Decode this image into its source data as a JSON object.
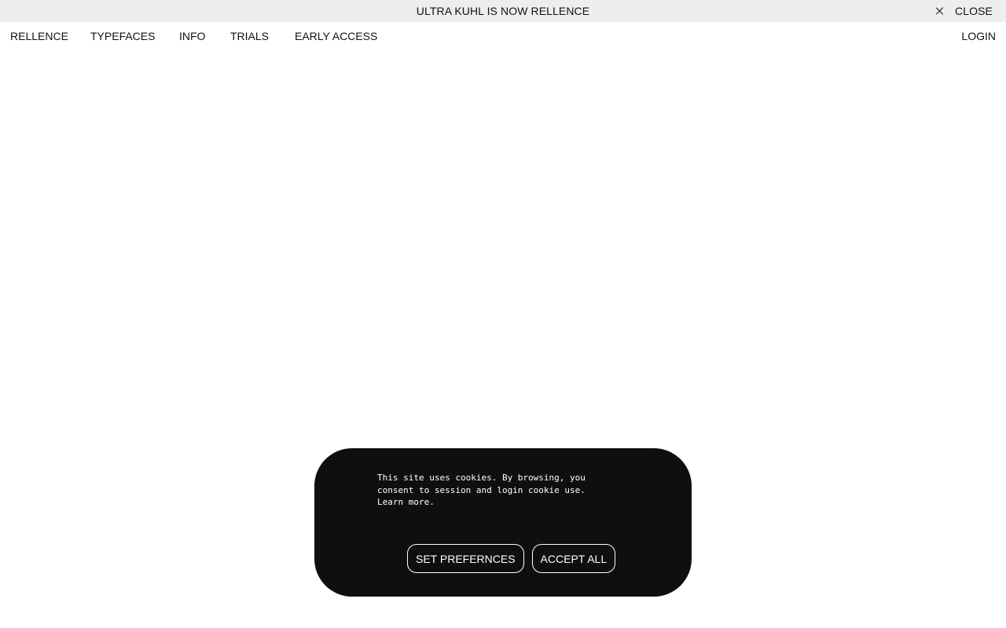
{
  "announcement": {
    "text": "ULTRA KUHL IS NOW RELLENCE",
    "close_label": "CLOSE"
  },
  "nav": {
    "items": [
      {
        "label": "RELLENCE"
      },
      {
        "label": "TYPEFACES"
      },
      {
        "label": "INFO"
      },
      {
        "label": "TRIALS"
      },
      {
        "label": "EARLY ACCESS"
      }
    ],
    "login_label": "LOGIN"
  },
  "cookie_banner": {
    "message": "This site uses cookies. By browsing, you consent to session and login cookie use.",
    "learn_more": "Learn more.",
    "set_preferences_label": "SET PREFERNCES",
    "accept_all_label": "ACCEPT ALL"
  },
  "colors": {
    "announcement_bg": "#eeeeee",
    "banner_bg": "#0f0f0f",
    "text": "#111111"
  }
}
